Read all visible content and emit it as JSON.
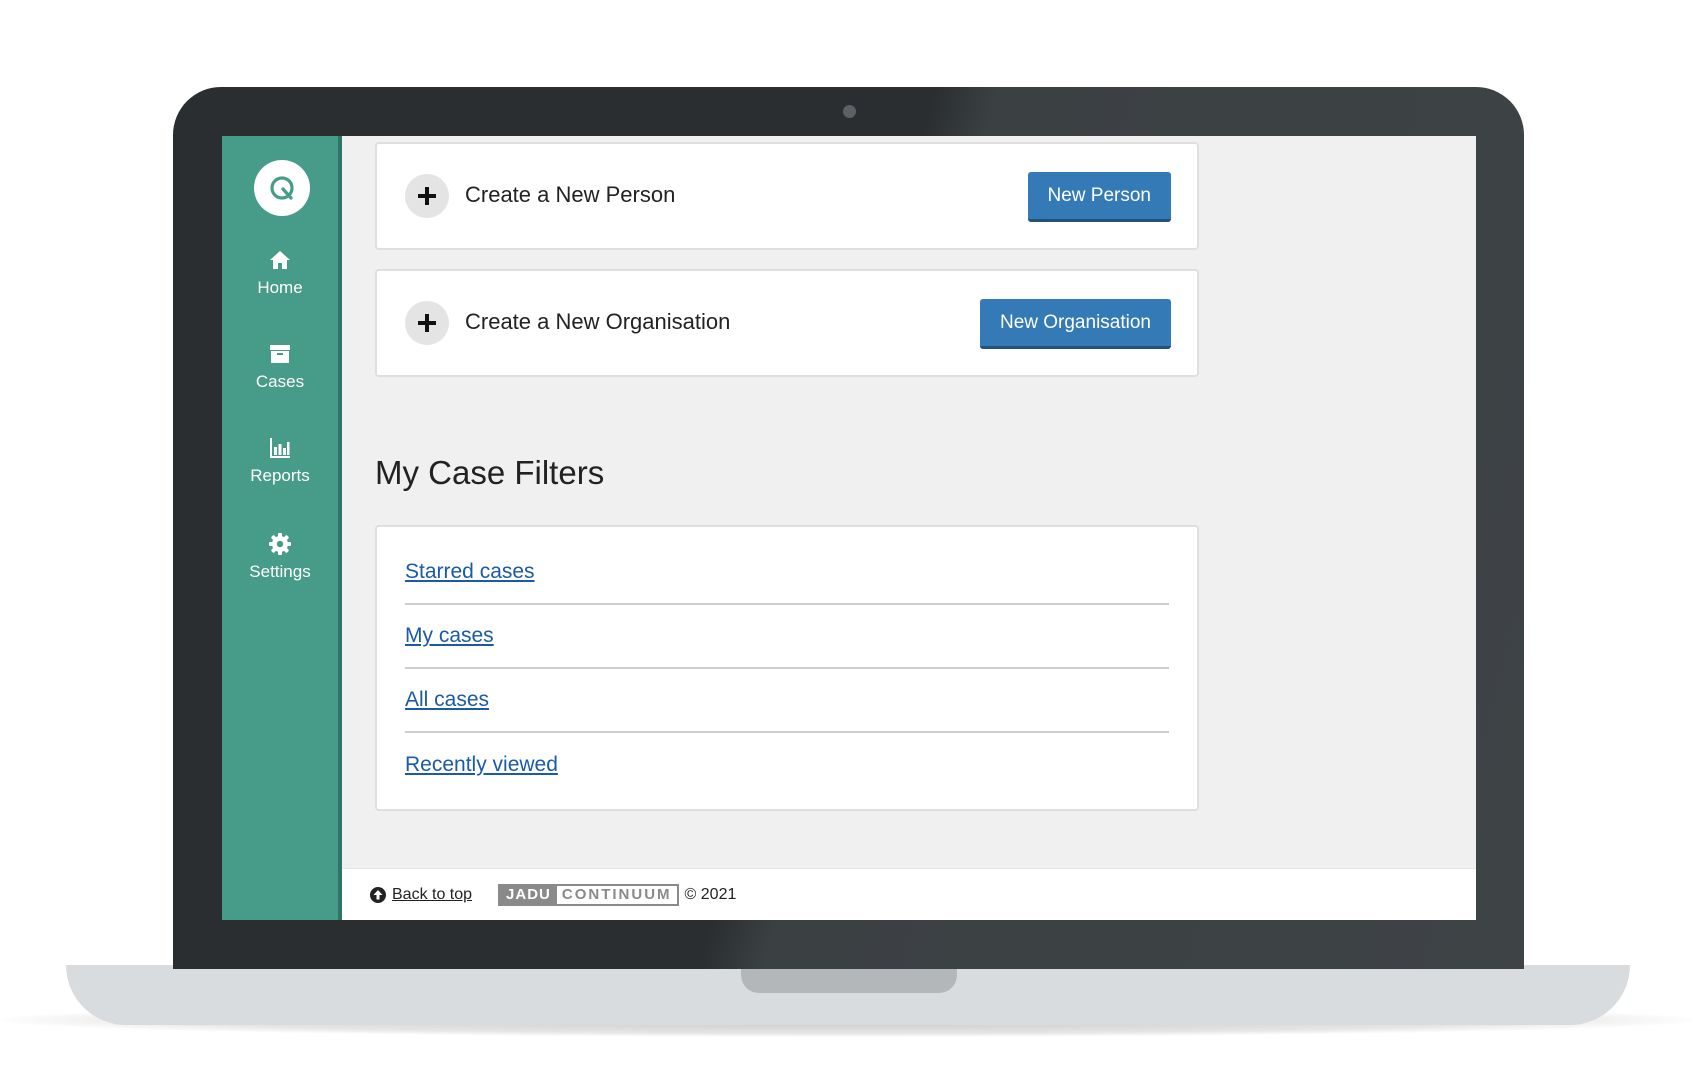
{
  "sidebar": {
    "items": [
      {
        "label": "Home",
        "icon": "home-icon"
      },
      {
        "label": "Cases",
        "icon": "archive-box-icon"
      },
      {
        "label": "Reports",
        "icon": "bar-chart-icon"
      },
      {
        "label": "Settings",
        "icon": "gear-icon"
      }
    ]
  },
  "main": {
    "create_person": {
      "title": "Create a New Person",
      "button": "New Person"
    },
    "create_organisation": {
      "title": "Create a New Organisation",
      "button": "New Organisation"
    },
    "filters": {
      "title": "My Case Filters",
      "links": [
        "Starred cases",
        "My cases",
        "All cases",
        "Recently viewed"
      ]
    }
  },
  "footer": {
    "back_to_top": "Back to top",
    "brand_part1": "JADU",
    "brand_part2": "CONTINUUM",
    "copyright": "© 2021"
  },
  "colors": {
    "sidebar": "#479b89",
    "button": "#337ab7",
    "link": "#1a5aa6",
    "bezel": "#2a2e31"
  }
}
